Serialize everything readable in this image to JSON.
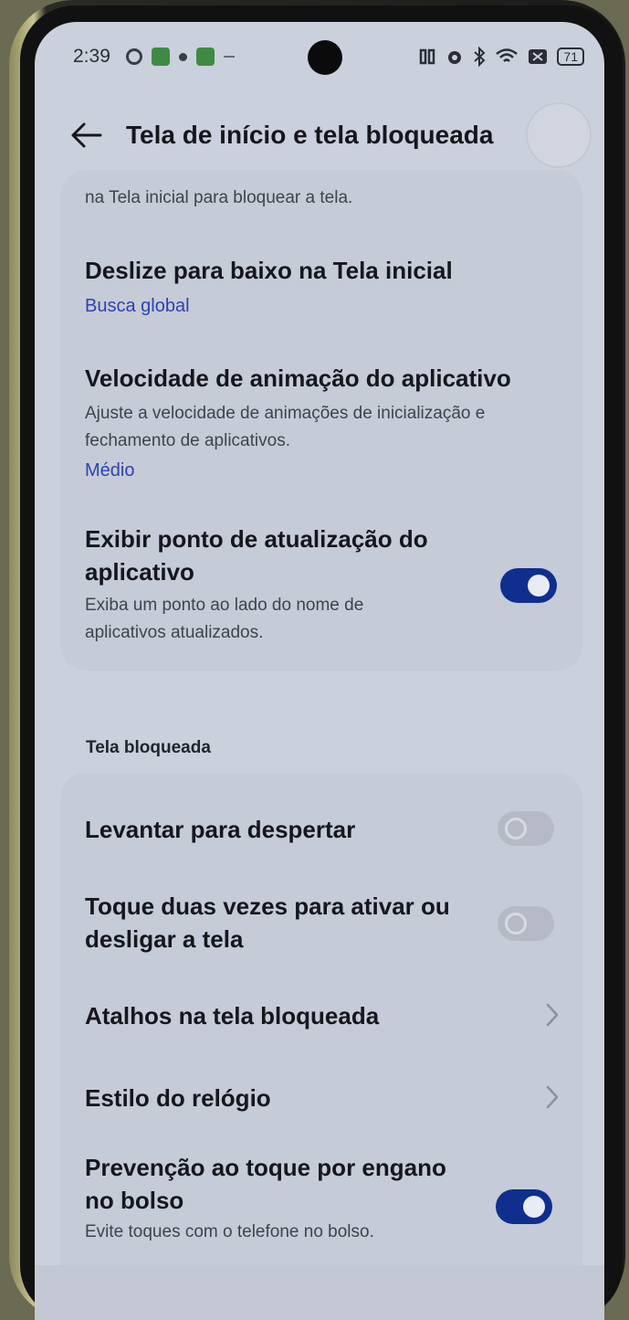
{
  "status_bar": {
    "time": "2:39",
    "battery": "71",
    "icons_left": [
      "whatsapp-icon",
      "app-icon-green",
      "dot-icon",
      "app-icon-green-2",
      "dash-icon"
    ],
    "icons_right": [
      "nfc-icon",
      "alarm-icon",
      "bluetooth-icon",
      "wifi-icon",
      "battery-saver-icon",
      "battery-icon"
    ]
  },
  "header": {
    "title": "Tela de início e tela bloqueada"
  },
  "home_screen": {
    "truncated_text": "na Tela inicial para bloquear a tela.",
    "swipe_down": {
      "title": "Deslize para baixo na Tela inicial",
      "value": "Busca global"
    },
    "animation_speed": {
      "title": "Velocidade de animação do aplicativo",
      "description": "Ajuste a velocidade de animações de inicialização e fechamento de aplicativos.",
      "value": "Médio"
    },
    "update_dot": {
      "title": "Exibir ponto de atualização do aplicativo",
      "description": "Exiba um ponto ao lado do nome de aplicativos atualizados.",
      "enabled": true
    }
  },
  "lock_screen": {
    "section_title": "Tela bloqueada",
    "items": [
      {
        "title": "Levantar para despertar",
        "type": "toggle",
        "enabled": false
      },
      {
        "title": "Toque duas vezes para ativar ou desligar a tela",
        "type": "toggle",
        "enabled": false
      },
      {
        "title": "Atalhos na tela bloqueada",
        "type": "link"
      },
      {
        "title": "Estilo do relógio",
        "type": "link"
      },
      {
        "title": "Prevenção ao toque por engano no bolso",
        "description": "Evite toques com o telefone no bolso.",
        "type": "toggle",
        "enabled": true
      }
    ]
  },
  "colors": {
    "background": "#cbd0dd",
    "card": "#c6cbd8",
    "accent": "#0f2e8e",
    "link_value": "#2c43b0"
  }
}
